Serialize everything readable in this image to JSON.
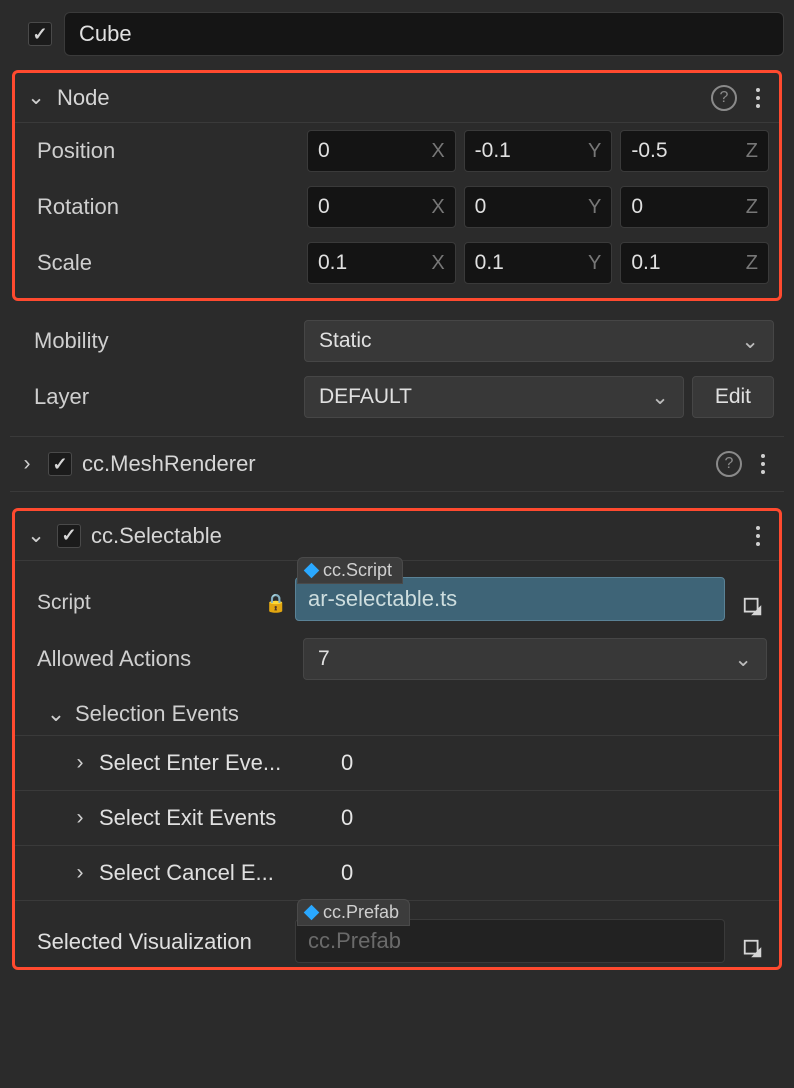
{
  "object": {
    "enabled": true,
    "name": "Cube"
  },
  "node": {
    "title": "Node",
    "position": {
      "label": "Position",
      "x": "0",
      "y": "-0.1",
      "z": "-0.5"
    },
    "rotation": {
      "label": "Rotation",
      "x": "0",
      "y": "0",
      "z": "0"
    },
    "scale": {
      "label": "Scale",
      "x": "0.1",
      "y": "0.1",
      "z": "0.1"
    },
    "axes": {
      "x": "X",
      "y": "Y",
      "z": "Z"
    }
  },
  "mobility": {
    "label": "Mobility",
    "value": "Static"
  },
  "layer": {
    "label": "Layer",
    "value": "DEFAULT",
    "edit": "Edit"
  },
  "meshRenderer": {
    "title": "cc.MeshRenderer",
    "enabled": true
  },
  "selectable": {
    "title": "cc.Selectable",
    "enabled": true,
    "script": {
      "label": "Script",
      "typeTag": "cc.Script",
      "value": "ar-selectable.ts"
    },
    "allowedActions": {
      "label": "Allowed Actions",
      "value": "7"
    },
    "selectionEvents": {
      "title": "Selection Events",
      "items": [
        {
          "label": "Select Enter Eve...",
          "count": "0"
        },
        {
          "label": "Select Exit Events",
          "count": "0"
        },
        {
          "label": "Select Cancel E...",
          "count": "0"
        }
      ]
    },
    "selectedVisualization": {
      "label": "Selected Visualization",
      "typeTag": "cc.Prefab",
      "placeholder": "cc.Prefab"
    }
  }
}
